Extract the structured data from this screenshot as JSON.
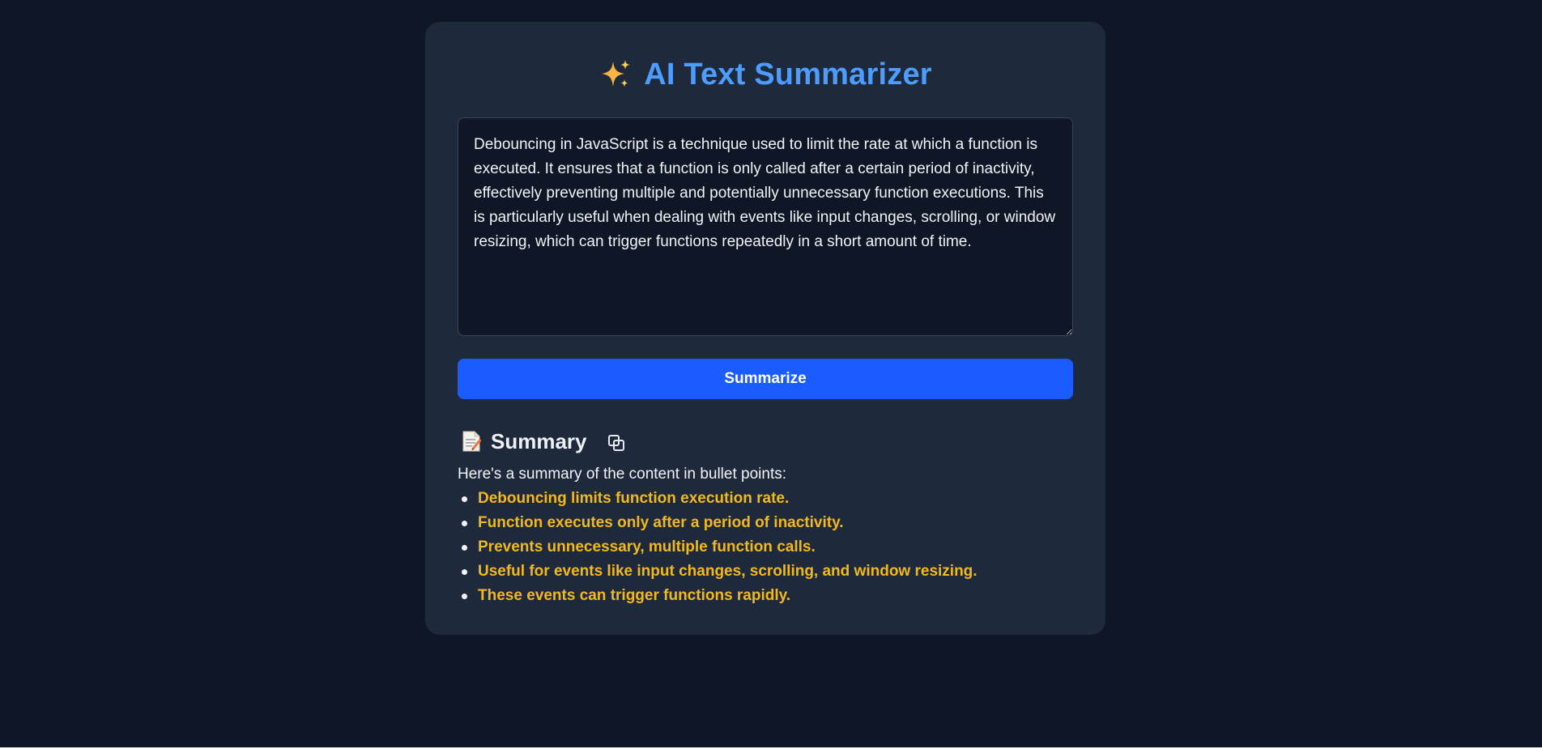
{
  "app": {
    "title": "AI Text Summarizer",
    "title_icon": "sparkles-icon",
    "accent_color": "#4c9dff"
  },
  "input": {
    "value": "Debouncing in JavaScript is a technique used to limit the rate at which a function is executed. It ensures that a function is only called after a certain period of inactivity, effectively preventing multiple and potentially unnecessary function executions. This is particularly useful when dealing with events like input changes, scrolling, or window resizing, which can trigger functions repeatedly in a short amount of time."
  },
  "actions": {
    "summarize_label": "Summarize",
    "button_color": "#1a5cff"
  },
  "summary": {
    "heading": "Summary",
    "heading_icon": "document-icon",
    "copy_icon": "copy-icon",
    "intro": "Here's a summary of the content in bullet points:",
    "bullet_color": "#f3b81a",
    "bullets": [
      "Debouncing limits function execution rate.",
      "Function executes only after a period of inactivity.",
      "Prevents unnecessary, multiple function calls.",
      "Useful for events like input changes, scrolling, and window resizing.",
      "These events can trigger functions rapidly."
    ]
  }
}
